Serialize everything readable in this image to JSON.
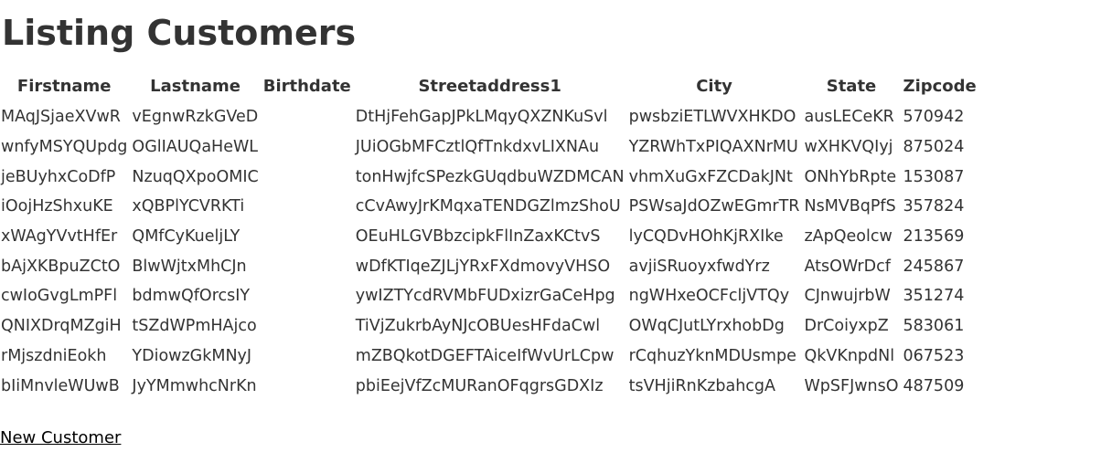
{
  "page": {
    "title": "Listing Customers",
    "new_customer_label": "New Customer"
  },
  "table": {
    "headers": [
      "Firstname",
      "Lastname",
      "Birthdate",
      "Streetaddress1",
      "City",
      "State",
      "Zipcode"
    ],
    "rows": [
      [
        "MAqJSjaeXVwR",
        "vEgnwRzkGVeD",
        "",
        "DtHjFehGapJPkLMqyQXZNKuSvl",
        "pwsbziETLWVXHKDO",
        "ausLECeKR",
        "570942"
      ],
      [
        "wnfyMSYQUpdg",
        "OGlIAUQaHeWL",
        "",
        "JUiOGbMFCztlQfTnkdxvLIXNAu",
        "YZRWhTxPIQAXNrMU",
        "wXHKVQIyj",
        "875024"
      ],
      [
        "jeBUyhxCoDfP",
        "NzuqQXpoOMIC",
        "",
        "tonHwjfcSPezkGUqdbuWZDMCAN",
        "vhmXuGxFZCDakJNt",
        "ONhYbRpte",
        "153087"
      ],
      [
        "iOojHzShxuKE",
        "xQBPlYCVRKTi",
        "",
        "cCvAwyJrKMqxaTENDGZlmzShoU",
        "PSWsaJdOZwEGmrTR",
        "NsMVBqPfS",
        "357824"
      ],
      [
        "xWAgYVvtHfEr",
        "QMfCyKueljLY",
        "",
        "OEuHLGVBbzcipkFlInZaxKCtvS",
        "lyCQDvHOhKjRXIke",
        "zApQeolcw",
        "213569"
      ],
      [
        "bAjXKBpuZCtO",
        "BlwWjtxMhCJn",
        "",
        "wDfKTIqeZJLjYRxFXdmovyVHSO",
        "avjiSRuoyxfwdYrz",
        "AtsOWrDcf",
        "245867"
      ],
      [
        "cwIoGvgLmPFl",
        "bdmwQfOrcsIY",
        "",
        "ywIZTYcdRVMbFUDxizrGaCeHpg",
        "ngWHxeOCFcljVTQy",
        "CJnwujrbW",
        "351274"
      ],
      [
        "QNIXDrqMZgiH",
        "tSZdWPmHAjco",
        "",
        "TiVjZukrbAyNJcOBUesHFdaCwl",
        "OWqCJutLYrxhobDg",
        "DrCoiyxpZ",
        "583061"
      ],
      [
        "rMjszdniEokh",
        "YDiowzGkMNyJ",
        "",
        "mZBQkotDGEFTAiceIfWvUrLCpw",
        "rCqhuzYknMDUsmpe",
        "QkVKnpdNl",
        "067523"
      ],
      [
        "bIiMnvleWUwB",
        "JyYMmwhcNrKn",
        "",
        "pbiEejVfZcMURanOFqgrsGDXIz",
        "tsVHjiRnKzbahcgA",
        "WpSFJwnsO",
        "487509"
      ]
    ]
  }
}
